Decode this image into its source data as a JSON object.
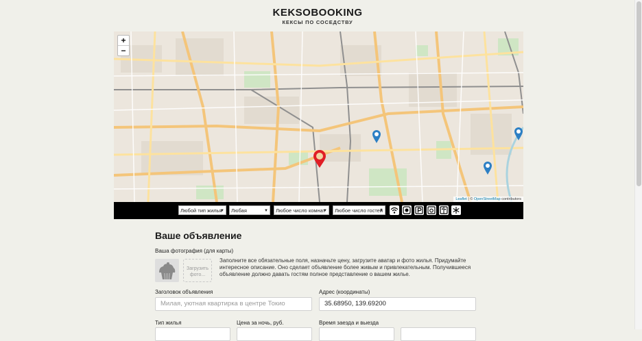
{
  "header": {
    "logo": "KEKSOBOOKING",
    "tagline": "КЕКСЫ ПО СОСЕДСТВУ"
  },
  "map": {
    "zoom_in": "+",
    "zoom_out": "−",
    "attribution_leaflet": "Leaflet",
    "attribution_sep": " | © ",
    "attribution_osm": "OpenStreetMap",
    "attribution_tail": " contributors"
  },
  "filters": {
    "housing_type": "Любой тип жилья",
    "price": "Любая",
    "rooms": "Любое число комнат",
    "guests": "Любое число гостей",
    "features": [
      "wifi-icon",
      "dishwasher-icon",
      "parking-icon",
      "washer-icon",
      "elevator-icon",
      "conditioner-icon"
    ]
  },
  "form": {
    "title": "Ваше объявление",
    "photo_label": "Ваша фотография (для карты)",
    "upload_label": "Загрузить фото...",
    "hint": "Заполните все обязательные поля, назначьте цену, загрузите аватар и фото жилья. Придумайте интересное описание. Оно сделает объявление более живым и привлекательным. Получившееся объявление должно давать гостям полное представление о вашем жилье.",
    "headline_label": "Заголовок объявления",
    "headline_placeholder": "Милая, уютная квартирка в центре Токио",
    "address_label": "Адрес (координаты)",
    "address_value": "35.68950, 139.69200",
    "type_label": "Тип жилья",
    "price_label": "Цена за ночь, руб.",
    "time_label": "Время заезда и выезда"
  },
  "colors": {
    "main_pin": "#e01e25",
    "pin": "#2c7fc4",
    "filters_bg": "#000000",
    "page_bg": "#f0f0ea"
  }
}
